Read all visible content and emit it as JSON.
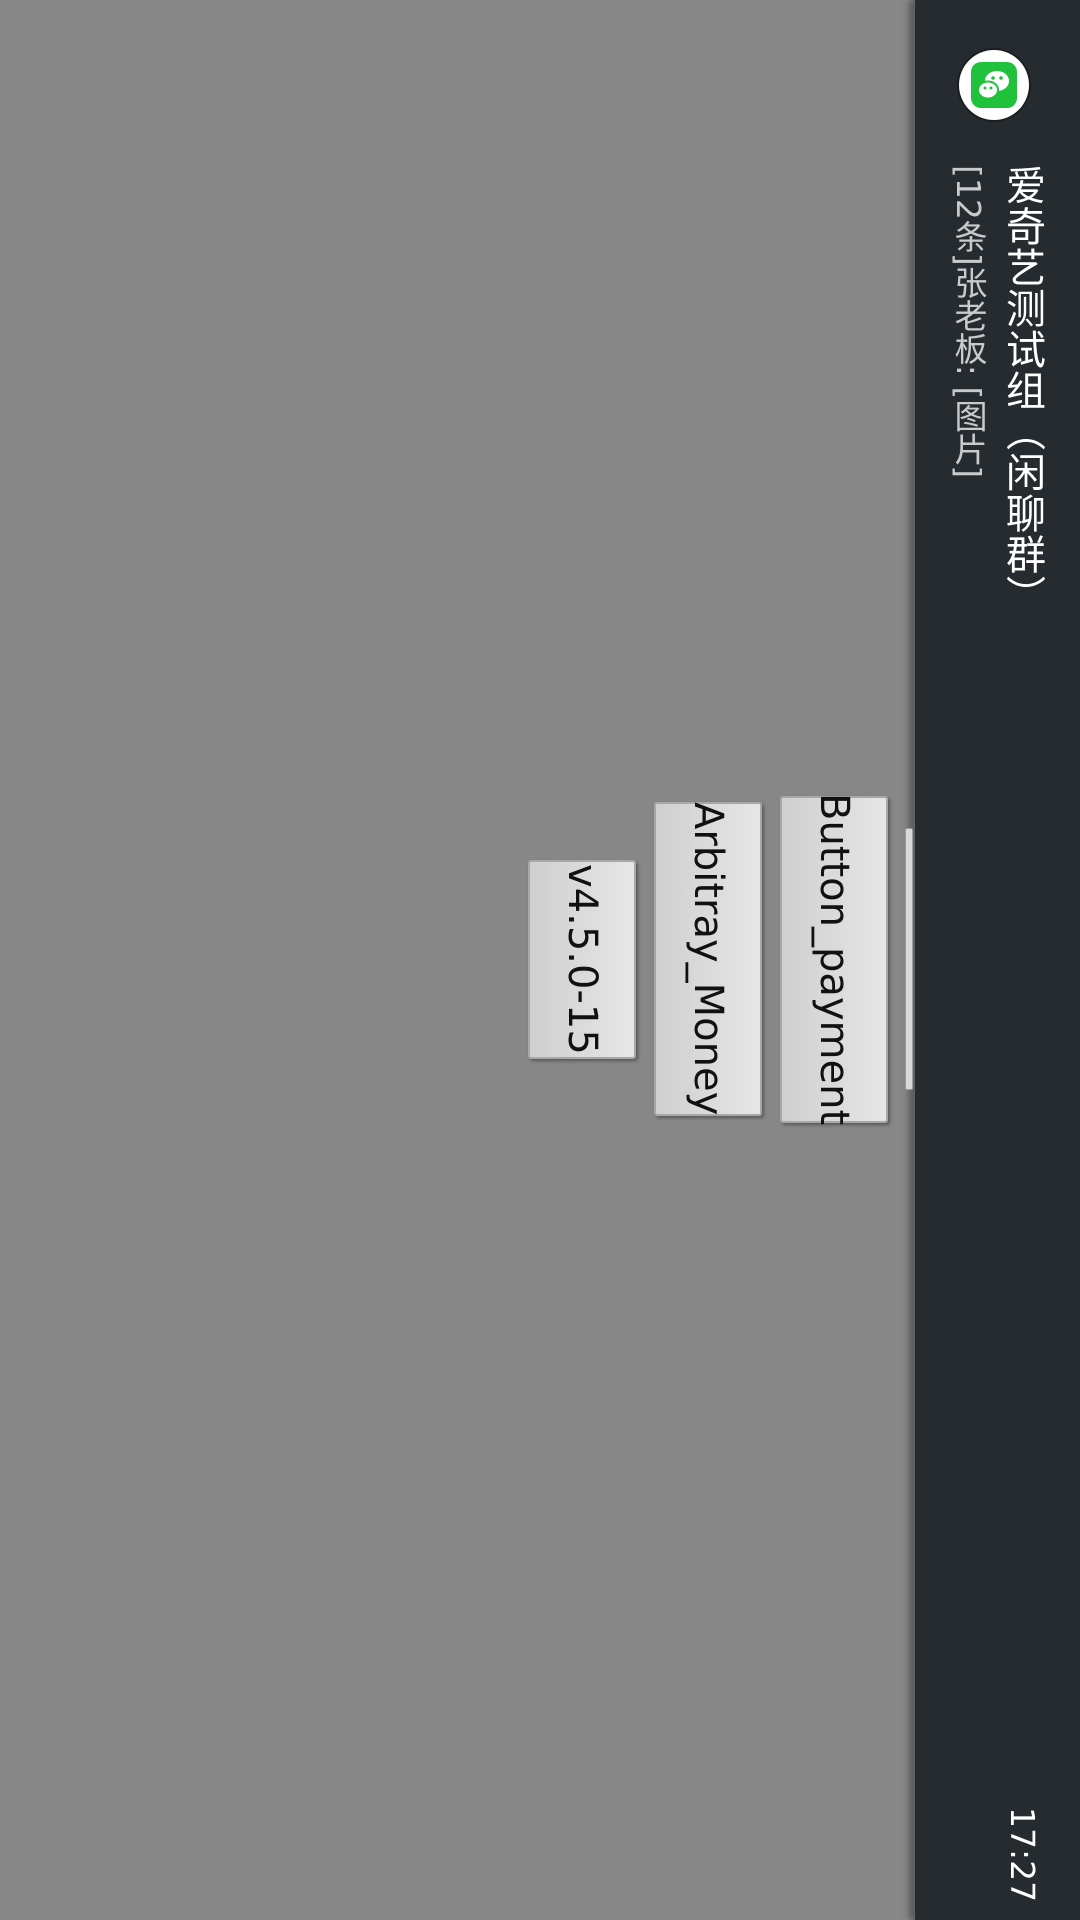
{
  "notification": {
    "app_icon": "wechat-icon",
    "title": "爱奇艺测试组（闲聊群）",
    "text": "[12条]张老板: [图片]",
    "time": "17:27"
  },
  "buttons": {
    "payment_label": "Button_payment",
    "arbitrary_label": "Arbitray_Money",
    "version_label": "v4.5.0-15"
  },
  "colors": {
    "background": "#878787",
    "panel": "#262b30",
    "icon_green": "#1fc23a"
  }
}
